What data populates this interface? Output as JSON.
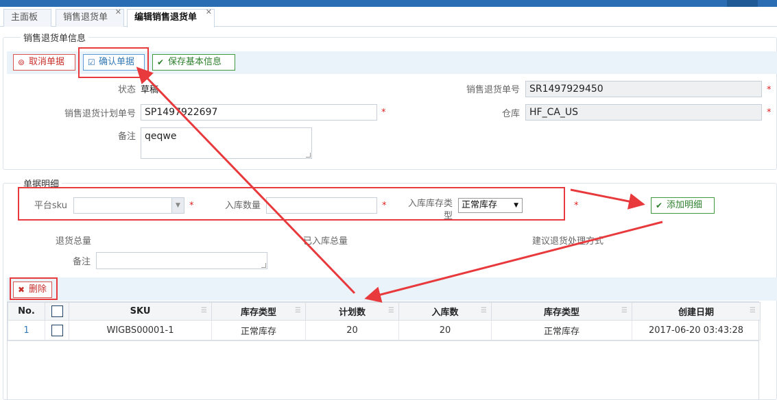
{
  "tabs": [
    {
      "label": "主面板"
    },
    {
      "label": "销售退货单"
    },
    {
      "label": "编辑销售退货单"
    }
  ],
  "info_section": {
    "legend": "销售退货单信息",
    "buttons": {
      "cancel": "取消单据",
      "confirm": "确认单据",
      "save": "保存基本信息"
    },
    "status_label": "状态",
    "status_value": "草稿",
    "return_no_label": "销售退货单号",
    "return_no_value": "SR1497929450",
    "plan_no_label": "销售退货计划单号",
    "plan_no_value": "SP1497922697",
    "warehouse_label": "仓库",
    "warehouse_value": "HF_CA_US",
    "remark_label": "备注",
    "remark_value": "qeqwe",
    "required_mark": "*"
  },
  "detail_section": {
    "legend": "单据明细",
    "sku_label": "平台sku",
    "sku_value": "",
    "qty_label": "入库数量",
    "qty_value": "",
    "stock_type_label": "入库库存类型",
    "stock_type_value": "正常库存",
    "add_button": "添加明细",
    "total_return_label": "退货总量",
    "in_total_label": "已入库总量",
    "suggest_label": "建议退货处理方式",
    "remark_label": "备注",
    "remark_value": "",
    "delete_button": "删除"
  },
  "grid": {
    "columns": [
      "No.",
      "",
      "SKU",
      "库存类型",
      "计划数",
      "入库数",
      "库存类型",
      "创建日期"
    ],
    "rows": [
      {
        "no": "1",
        "sku": "WIGBS00001-1",
        "stock_type": "正常库存",
        "plan_qty": "20",
        "in_qty": "20",
        "stock_type2": "正常库存",
        "created": "2017-06-20 03:43:28"
      }
    ]
  },
  "colors": {
    "accent": "#2a6db2",
    "annotation_red": "#e8393c"
  }
}
